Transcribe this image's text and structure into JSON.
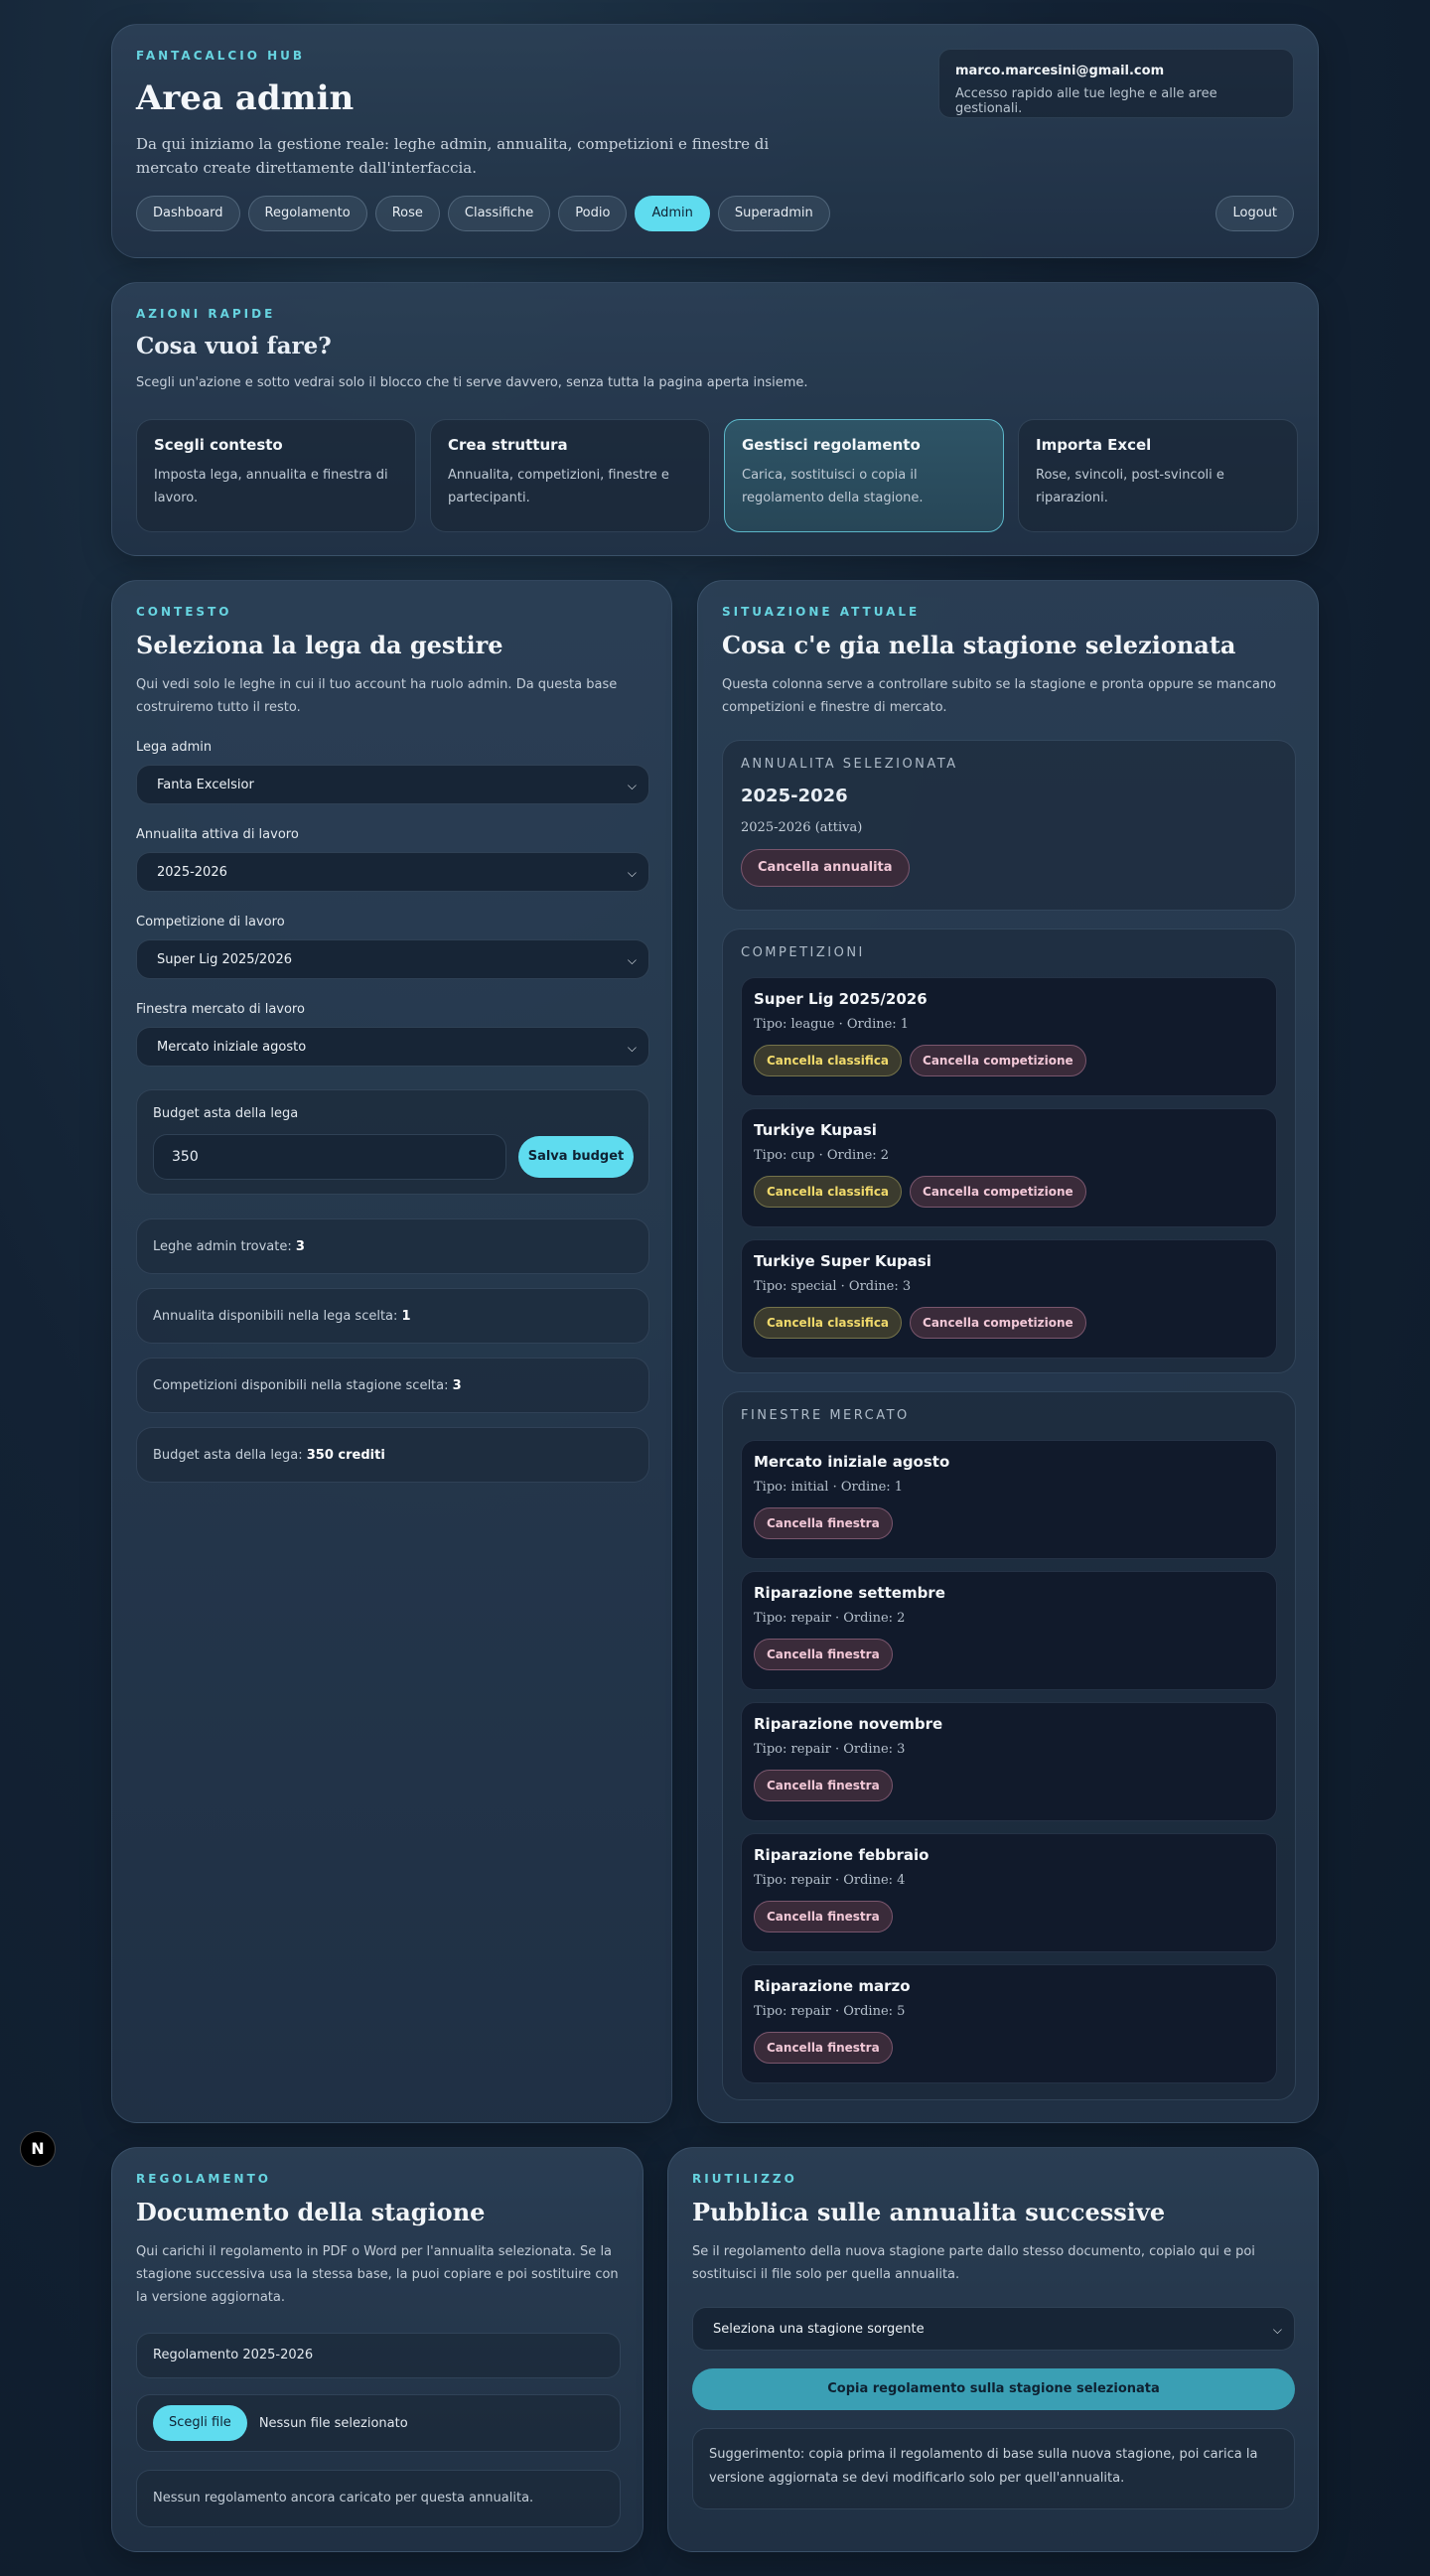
{
  "header": {
    "kicker": "FANTACALCIO HUB",
    "title": "Area admin",
    "description": "Da qui iniziamo la gestione reale: leghe admin, annualita, competizioni e finestre di mercato create direttamente dall'interfaccia.",
    "nav": [
      "Dashboard",
      "Regolamento",
      "Rose",
      "Classifiche",
      "Podio",
      "Admin",
      "Superadmin"
    ],
    "active_nav": "Admin",
    "user_email": "marco.marcesini@gmail.com",
    "user_sub": "Accesso rapido alle tue leghe e alle aree gestionali.",
    "logout": "Logout"
  },
  "quick": {
    "kicker": "AZIONI RAPIDE",
    "title": "Cosa vuoi fare?",
    "description": "Scegli un'azione e sotto vedrai solo il blocco che ti serve davvero, senza tutta la pagina aperta insieme.",
    "actions": [
      {
        "title": "Scegli contesto",
        "desc": "Imposta lega, annualita e finestra di lavoro."
      },
      {
        "title": "Crea struttura",
        "desc": "Annualita, competizioni, finestre e partecipanti."
      },
      {
        "title": "Gestisci regolamento",
        "desc": "Carica, sostituisci o copia il regolamento della stagione."
      },
      {
        "title": "Importa Excel",
        "desc": "Rose, svincoli, post-svincoli e riparazioni."
      }
    ]
  },
  "context": {
    "kicker": "CONTESTO",
    "title": "Seleziona la lega da gestire",
    "description": "Qui vedi solo le leghe in cui il tuo account ha ruolo admin. Da questa base costruiremo tutto il resto.",
    "league_label": "Lega admin",
    "league_value": "Fanta Excelsior",
    "season_label": "Annualita attiva di lavoro",
    "season_value": "2025-2026",
    "competition_label": "Competizione di lavoro",
    "competition_value": "Super Lig 2025/2026",
    "window_label": "Finestra mercato di lavoro",
    "window_value": "Mercato iniziale agosto",
    "budget_label": "Budget asta della lega",
    "budget_value": "350",
    "save_budget": "Salva budget",
    "stats": [
      {
        "label": "Leghe admin trovate:",
        "value": "3"
      },
      {
        "label": "Annualita disponibili nella lega scelta:",
        "value": "1"
      },
      {
        "label": "Competizioni disponibili nella stagione scelta:",
        "value": "3"
      },
      {
        "label": "Budget asta della lega:",
        "value": "350 crediti"
      }
    ]
  },
  "situation": {
    "kicker": "SITUAZIONE ATTUALE",
    "title": "Cosa c'e gia nella stagione selezionata",
    "description": "Questa colonna serve a controllare subito se la stagione e pronta oppure se mancano competizioni e finestre di mercato.",
    "season_kicker": "ANNUALITA SELEZIONATA",
    "season_title": "2025-2026",
    "season_status": "2025-2026 (attiva)",
    "cancel_season": "Cancella annualita",
    "competitions_kicker": "COMPETIZIONI",
    "competitions": [
      {
        "title": "Super Lig 2025/2026",
        "meta": "Tipo: league · Ordine: 1"
      },
      {
        "title": "Turkiye Kupasi",
        "meta": "Tipo: cup · Ordine: 2"
      },
      {
        "title": "Turkiye Super Kupasi",
        "meta": "Tipo: special · Ordine: 3"
      }
    ],
    "cancel_ranking": "Cancella classifica",
    "cancel_competition": "Cancella competizione",
    "windows_kicker": "FINESTRE MERCATO",
    "windows": [
      {
        "title": "Mercato iniziale agosto",
        "meta": "Tipo: initial · Ordine: 1"
      },
      {
        "title": "Riparazione settembre",
        "meta": "Tipo: repair · Ordine: 2"
      },
      {
        "title": "Riparazione novembre",
        "meta": "Tipo: repair · Ordine: 3"
      },
      {
        "title": "Riparazione febbraio",
        "meta": "Tipo: repair · Ordine: 4"
      },
      {
        "title": "Riparazione marzo",
        "meta": "Tipo: repair · Ordine: 5"
      }
    ],
    "cancel_window": "Cancella finestra"
  },
  "regulation": {
    "kicker": "REGOLAMENTO",
    "title": "Documento della stagione",
    "description": "Qui carichi il regolamento in PDF o Word per l'annualita selezionata. Se la stagione successiva usa la stessa base, la puoi copiare e poi sostituire con la versione aggiornata.",
    "doc_name": "Regolamento 2025-2026",
    "choose_file": "Scegli file",
    "no_file": "Nessun file selezionato",
    "empty_note": "Nessun regolamento ancora caricato per questa annualita."
  },
  "reuse": {
    "kicker": "RIUTILIZZO",
    "title": "Pubblica sulle annualita successive",
    "description": "Se il regolamento della nuova stagione parte dallo stesso documento, copialo qui e poi sostituisci il file solo per quella annualita.",
    "source_placeholder": "Seleziona una stagione sorgente",
    "copy_button": "Copia regolamento sulla stagione selezionata",
    "tip": "Suggerimento: copia prima il regolamento di base sulla nuova stagione, poi carica la versione aggiornata se devi modificarlo solo per quell'annualita."
  },
  "badge": "N",
  "colors": {
    "accent": "#5fdcef",
    "background": "#132234",
    "warn_chip": "#f1da6b",
    "danger_chip": "#f1c7d6"
  }
}
